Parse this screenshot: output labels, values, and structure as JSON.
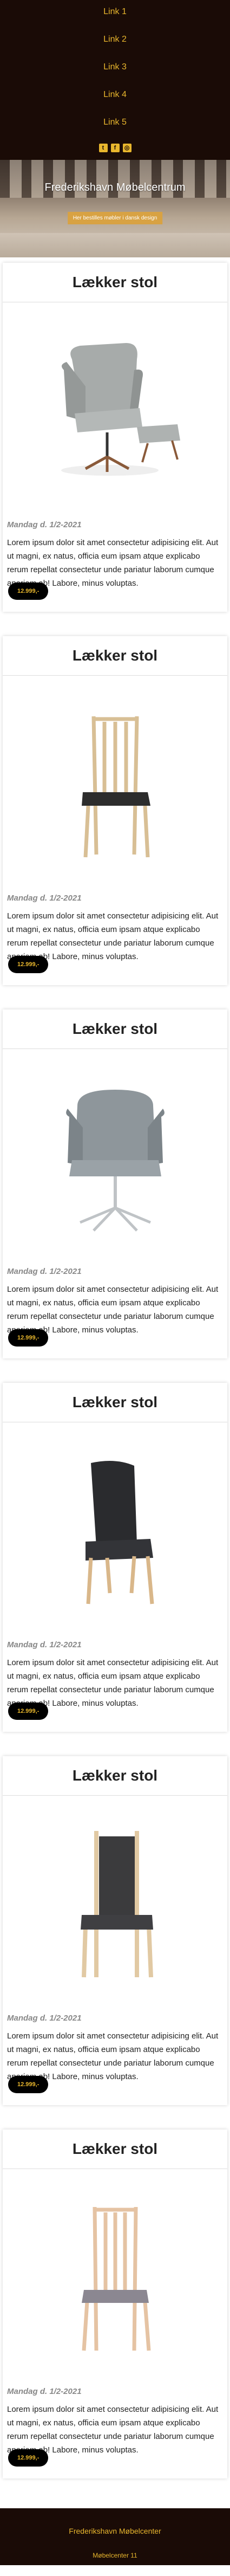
{
  "nav": {
    "links": [
      "Link 1",
      "Link 2",
      "Link 3",
      "Link 4",
      "Link 5"
    ],
    "social_icons": [
      "twitter-icon",
      "facebook-icon",
      "instagram-icon"
    ]
  },
  "hero": {
    "title": "Frederikshavn Møbelcentrum",
    "tagline": "Her bestilles møbler i dansk design"
  },
  "cards": [
    {
      "title": "Lækker stol",
      "date": "Mandag d. 1/2-2021",
      "text": "Lorem ipsum dolor sit amet consectetur adipisicing elit. Aut ut magni, ex natus, officia eum ipsam atque explicabo rerum repellat consectetur unde pariatur laborum cumque aperiam ab! Labore, minus voluptas.",
      "price": "12.999,-",
      "image": "lounge-chair"
    },
    {
      "title": "Lækker stol",
      "date": "Mandag d. 1/2-2021",
      "text": "Lorem ipsum dolor sit amet consectetur adipisicing elit. Aut ut magni, ex natus, officia eum ipsam atque explicabo rerum repellat consectetur unde pariatur laborum cumque aperiam ab! Labore, minus voluptas.",
      "price": "12.999,-",
      "image": "spindle-chair"
    },
    {
      "title": "Lækker stol",
      "date": "Mandag d. 1/2-2021",
      "text": "Lorem ipsum dolor sit amet consectetur adipisicing elit. Aut ut magni, ex natus, officia eum ipsam atque explicabo rerum repellat consectetur unde pariatur laborum cumque aperiam ab! Labore, minus voluptas.",
      "price": "12.999,-",
      "image": "swivel-chair"
    },
    {
      "title": "Lækker stol",
      "date": "Mandag d. 1/2-2021",
      "text": "Lorem ipsum dolor sit amet consectetur adipisicing elit. Aut ut magni, ex natus, officia eum ipsam atque explicabo rerum repellat consectetur unde pariatur laborum cumque aperiam ab! Labore, minus voluptas.",
      "price": "12.999,-",
      "image": "dining-chair-black"
    },
    {
      "title": "Lækker stol",
      "date": "Mandag d. 1/2-2021",
      "text": "Lorem ipsum dolor sit amet consectetur adipisicing elit. Aut ut magni, ex natus, officia eum ipsam atque explicabo rerum repellat consectetur unde pariatur laborum cumque aperiam ab! Labore, minus voluptas.",
      "price": "12.999,-",
      "image": "dining-chair-framed"
    },
    {
      "title": "Lækker stol",
      "date": "Mandag d. 1/2-2021",
      "text": "Lorem ipsum dolor sit amet consectetur adipisicing elit. Aut ut magni, ex natus, officia eum ipsam atque explicabo rerum repellat consectetur unde pariatur laborum cumque aperiam ab! Labore, minus voluptas.",
      "price": "12.999,-",
      "image": "slat-chair"
    }
  ],
  "footer": {
    "name": "Frederikshavn Møbelcenter",
    "address": "Møbelcenter 11"
  },
  "colors": {
    "accent": "#e8b62d",
    "dark": "#1a0b06"
  }
}
